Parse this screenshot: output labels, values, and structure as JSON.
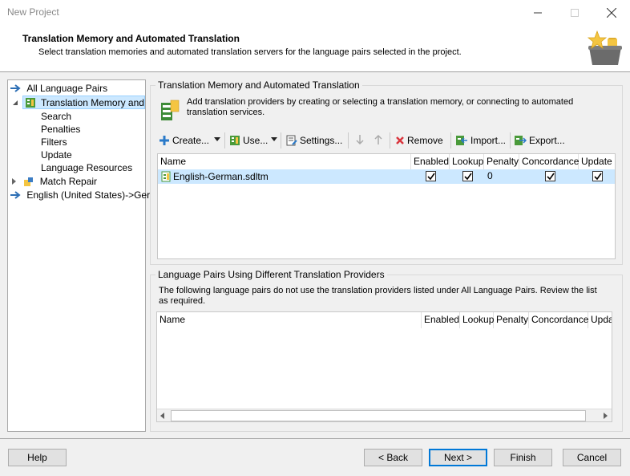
{
  "window": {
    "title": "New Project"
  },
  "header": {
    "title": "Translation Memory and Automated Translation",
    "subtitle": "Select translation memories and automated translation servers for the language pairs selected in the project."
  },
  "tree": {
    "items": [
      {
        "label": "All Language Pairs"
      },
      {
        "label": "Translation Memory and"
      },
      {
        "label": "Search"
      },
      {
        "label": "Penalties"
      },
      {
        "label": "Filters"
      },
      {
        "label": "Update"
      },
      {
        "label": "Language Resources"
      },
      {
        "label": "Match Repair"
      },
      {
        "label": "English (United States)->Ger"
      }
    ]
  },
  "tm_group": {
    "title": "Translation Memory and Automated Translation",
    "description": "Add translation providers by creating or selecting a translation memory, or connecting to automated translation services.",
    "toolbar": {
      "create": "Create...",
      "use": "Use...",
      "settings": "Settings...",
      "remove": "Remove",
      "import": "Import...",
      "export": "Export..."
    },
    "columns": [
      "Name",
      "Enabled",
      "Lookup",
      "Penalty",
      "Concordance",
      "Update"
    ],
    "rows": [
      {
        "name": "English-German.sdltm",
        "enabled": true,
        "lookup": true,
        "penalty": "0",
        "concordance": true,
        "update": true
      }
    ]
  },
  "lp_group": {
    "title": "Language Pairs Using Different Translation Providers",
    "description": "The following language pairs do not use the translation providers listed under All Language Pairs. Review the list as required.",
    "columns": [
      "Name",
      "Enabled",
      "Lookup",
      "Penalty",
      "Concordance",
      "Upda"
    ]
  },
  "footer": {
    "help": "Help",
    "back": "< Back",
    "next": "Next >",
    "finish": "Finish",
    "cancel": "Cancel"
  }
}
